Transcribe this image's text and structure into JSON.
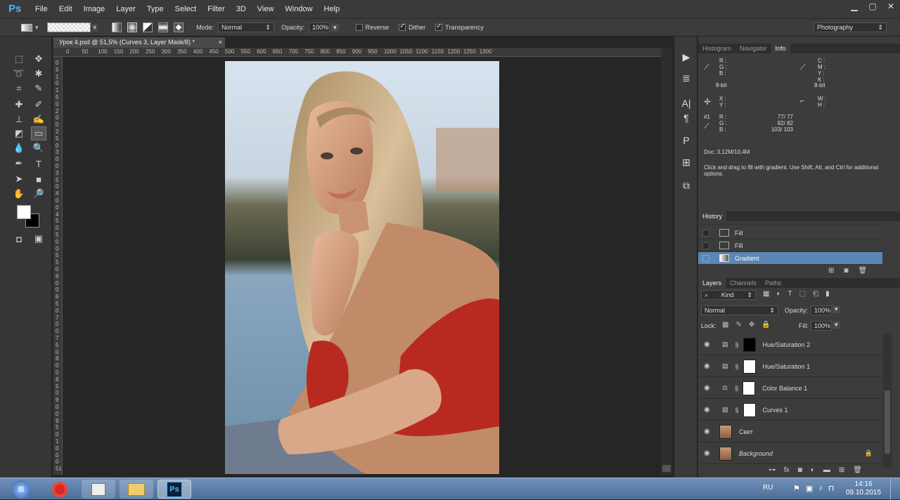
{
  "app": {
    "logo": "Ps"
  },
  "menu": [
    "File",
    "Edit",
    "Image",
    "Layer",
    "Type",
    "Select",
    "Filter",
    "3D",
    "View",
    "Window",
    "Help"
  ],
  "options": {
    "mode_label": "Mode:",
    "mode_value": "Normal",
    "opacity_label": "Opacity:",
    "opacity_value": "100%",
    "reverse": "Reverse",
    "dither": "Dither",
    "transparency": "Transparency",
    "workspace": "Photography"
  },
  "document": {
    "tab_title": "Урок 4.psd @ 51,5% (Curves 3, Layer Mask/8) *",
    "ruler_h": [
      "0",
      "50",
      "100",
      "150",
      "200",
      "250",
      "300",
      "350",
      "400",
      "450",
      "500",
      "550",
      "600",
      "650",
      "700",
      "750",
      "800",
      "850",
      "900",
      "950",
      "1000",
      "1050",
      "1100",
      "1150",
      "1200",
      "1250",
      "1300"
    ],
    "ruler_v": [
      "0",
      "5",
      "1",
      "0",
      "1",
      "5",
      "0",
      "2",
      "0",
      "0",
      "2",
      "5",
      "0",
      "3",
      "0",
      "0",
      "3",
      "5",
      "0",
      "4",
      "0",
      "0",
      "4",
      "5",
      "0",
      "5",
      "0",
      "0",
      "5",
      "5",
      "0",
      "6",
      "0",
      "0",
      "6",
      "5",
      "0",
      "7",
      "0",
      "0",
      "7",
      "5",
      "0",
      "8",
      "0",
      "0",
      "8",
      "5",
      "0",
      "9",
      "0",
      "0",
      "9",
      "5",
      "0",
      "1",
      "0",
      "0",
      "0",
      "51"
    ]
  },
  "info_panel": {
    "tabs": [
      "Histogram",
      "Navigator",
      "Info"
    ],
    "rgb": [
      "R :",
      "G :",
      "B :"
    ],
    "cmyk": [
      "C :",
      "M :",
      "Y :",
      "K :"
    ],
    "bit1": "8-bit",
    "bit2": "8-bit",
    "xy": [
      "X :",
      "Y :"
    ],
    "wh": [
      "W :",
      "H :"
    ],
    "sample": [
      "#1",
      "R :",
      "G :",
      "B :"
    ],
    "sample_vals": [
      "77/  77",
      "82/  82",
      "103/  103"
    ],
    "doc": "Doc: 3,12M/10,4M",
    "hint": "Click and drag to fill with gradient.  Use Shift, Alt, and Ctrl for additional options."
  },
  "history": {
    "title": "History",
    "items": [
      "Fill",
      "Fill",
      "Gradient"
    ]
  },
  "layers": {
    "tabs": [
      "Layers",
      "Channels",
      "Paths"
    ],
    "kind": "Kind",
    "blend": "Normal",
    "opacity_label": "Opacity:",
    "opacity": "100%",
    "lock_label": "Lock:",
    "fill_label": "Fill:",
    "fill": "100%",
    "items": [
      {
        "name": "Hue/Saturation 2",
        "icon": "hue-sat-icon"
      },
      {
        "name": "Hue/Saturation 1",
        "icon": "hue-sat-icon"
      },
      {
        "name": "Color Balance 1",
        "icon": "color-balance-icon"
      },
      {
        "name": "Curves 1",
        "icon": "curves-icon"
      },
      {
        "name": "Свет",
        "icon": "photo"
      },
      {
        "name": "Background",
        "icon": "photo"
      }
    ]
  },
  "taskbar": {
    "lang": "RU",
    "time": "14:16",
    "date": "09.10.2015",
    "ps_label": "Ps"
  }
}
